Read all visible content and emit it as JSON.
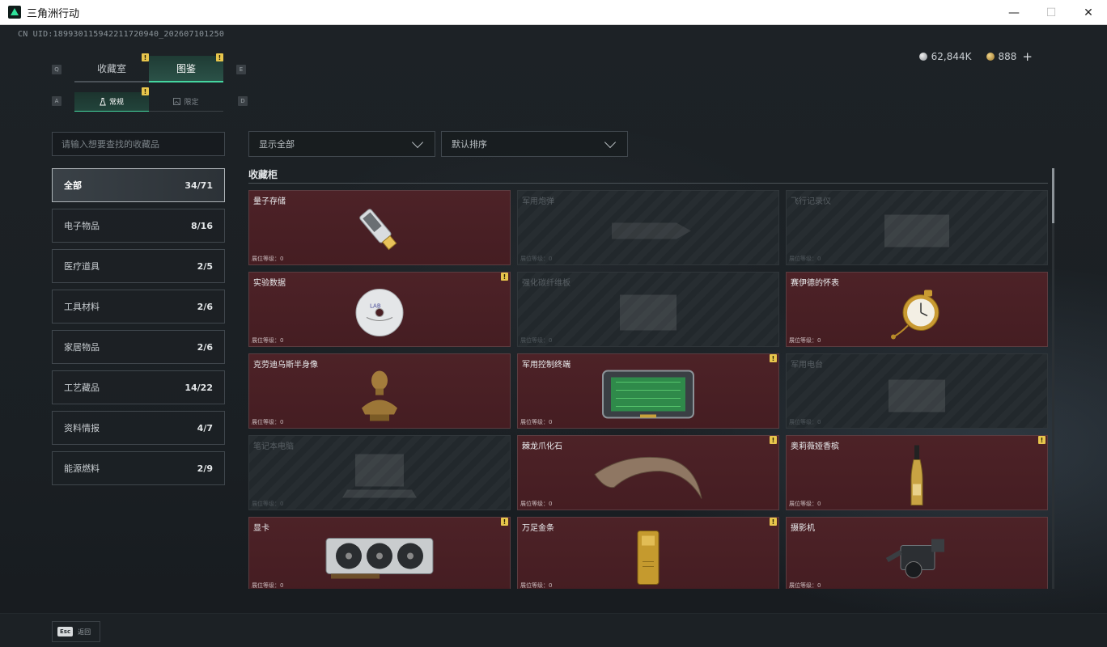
{
  "window": {
    "title": "三角洲行动",
    "minimize": "—",
    "maximize": "☐",
    "close": "✕"
  },
  "uid": "CN UID:1899301159422117209​40_202607101250",
  "currency": {
    "silver": "62,844K",
    "gold": "888",
    "plus": "+"
  },
  "keys": {
    "q": "Q",
    "e": "E",
    "a": "A",
    "d": "D"
  },
  "tabs": [
    {
      "label": "收藏室",
      "badge": "!"
    },
    {
      "label": "图鉴",
      "badge": "!"
    }
  ],
  "subtabs": [
    {
      "label": "常规",
      "badge": "!"
    },
    {
      "label": "限定"
    }
  ],
  "search": {
    "placeholder": "请输入想要查找的收藏品"
  },
  "categories": [
    {
      "label": "全部",
      "count": "34/71"
    },
    {
      "label": "电子物品",
      "count": "8/16"
    },
    {
      "label": "医疗道具",
      "count": "2/5"
    },
    {
      "label": "工具材料",
      "count": "2/6"
    },
    {
      "label": "家居物品",
      "count": "2/6"
    },
    {
      "label": "工艺藏品",
      "count": "14/22"
    },
    {
      "label": "资料情报",
      "count": "4/7"
    },
    {
      "label": "能源燃料",
      "count": "2/9"
    }
  ],
  "filters": {
    "show": "显示全部",
    "sort": "默认排序"
  },
  "section": {
    "title": "收藏柜"
  },
  "level_label": "展位等级：0",
  "items": [
    {
      "name": "量子存储",
      "icon": "usb-drive-icon",
      "locked": false,
      "badge": ""
    },
    {
      "name": "军用炮弹",
      "icon": "shell-icon",
      "locked": true,
      "badge": ""
    },
    {
      "name": "飞行记录仪",
      "icon": "flight-recorder-icon",
      "locked": true,
      "badge": ""
    },
    {
      "name": "实验数据",
      "icon": "disc-icon",
      "locked": false,
      "badge": "!"
    },
    {
      "name": "强化碳纤维板",
      "icon": "carbon-plate-icon",
      "locked": true,
      "badge": ""
    },
    {
      "name": "赛伊德的怀表",
      "icon": "pocket-watch-icon",
      "locked": false,
      "badge": ""
    },
    {
      "name": "克劳迪乌斯半身像",
      "icon": "bust-icon",
      "locked": false,
      "badge": ""
    },
    {
      "name": "军用控制终端",
      "icon": "control-terminal-icon",
      "locked": false,
      "badge": "!"
    },
    {
      "name": "军用电台",
      "icon": "radio-icon",
      "locked": true,
      "badge": ""
    },
    {
      "name": "笔记本电脑",
      "icon": "laptop-icon",
      "locked": true,
      "badge": ""
    },
    {
      "name": "棘龙爪化石",
      "icon": "claw-fossil-icon",
      "locked": false,
      "badge": "!"
    },
    {
      "name": "奥莉薇娅香槟",
      "icon": "champagne-icon",
      "locked": false,
      "badge": "!"
    },
    {
      "name": "显卡",
      "icon": "graphics-card-icon",
      "locked": false,
      "badge": "!"
    },
    {
      "name": "万足金条",
      "icon": "gold-bar-icon",
      "locked": false,
      "badge": "!"
    },
    {
      "name": "摄影机",
      "icon": "camera-icon",
      "locked": false,
      "badge": ""
    }
  ],
  "footer": {
    "esc": "Esc",
    "back": "返回"
  }
}
